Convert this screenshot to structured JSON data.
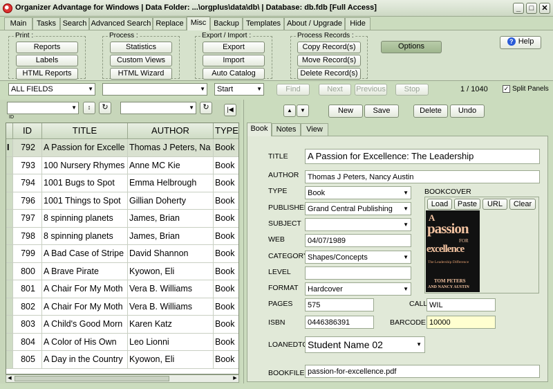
{
  "window": {
    "title": "Organizer Advantage for Windows | Data Folder: ...\\orgplus\\data\\db\\ | Database: db.fdb [Full Access]",
    "minimize": "_",
    "restore": "□",
    "close": "✕"
  },
  "tabs": [
    "Main",
    "Tasks",
    "Search",
    "Advanced Search",
    "Replace",
    "Misc",
    "Backup",
    "Templates",
    "About / Upgrade",
    "Hide"
  ],
  "ribbon": {
    "print": {
      "label": "Print :",
      "buttons": [
        "Reports",
        "Labels",
        "HTML Reports"
      ]
    },
    "process": {
      "label": "Process :",
      "buttons": [
        "Statistics",
        "Custom Views",
        "HTML Wizard"
      ]
    },
    "export_import": {
      "label": "Export / Import :",
      "buttons": [
        "Export",
        "Import",
        "Auto Catalog"
      ]
    },
    "process_records": {
      "label": "Process Records :",
      "buttons": [
        "Copy Record(s)",
        "Move Record(s)",
        "Delete Record(s)"
      ]
    },
    "options": "Options",
    "help": "Help"
  },
  "searchbar": {
    "field": "ALL FIELDS",
    "value": "",
    "mode": "Start",
    "find": "Find",
    "next": "Next",
    "previous": "Previous",
    "stop": "Stop",
    "record_counter": "1 / 1040",
    "split_panels": "Split Panels",
    "split_checked": true
  },
  "filter": {
    "sort_field": "",
    "sort_label": "ID",
    "filter2": ""
  },
  "grid": {
    "columns": [
      "ID",
      "TITLE",
      "AUTHOR",
      "TYPE"
    ],
    "rows": [
      {
        "marker": "I",
        "id": "792",
        "title": "A Passion for Excelle",
        "author": "Thomas J Peters, Na",
        "type": "Book",
        "selected": true
      },
      {
        "marker": "",
        "id": "793",
        "title": "100 Nursery Rhymes",
        "author": "Anne MC Kie",
        "type": "Book",
        "selected": false
      },
      {
        "marker": "",
        "id": "794",
        "title": "1001 Bugs to Spot",
        "author": "Emma Helbrough",
        "type": "Book",
        "selected": false
      },
      {
        "marker": "",
        "id": "796",
        "title": "1001 Things to Spot",
        "author": "Gillian Doherty",
        "type": "Book",
        "selected": false
      },
      {
        "marker": "",
        "id": "797",
        "title": "8 spinning planets",
        "author": "James, Brian",
        "type": "Book",
        "selected": false
      },
      {
        "marker": "",
        "id": "798",
        "title": "8 spinning planets",
        "author": "James, Brian",
        "type": "Book",
        "selected": false
      },
      {
        "marker": "",
        "id": "799",
        "title": "A Bad Case of Stripe",
        "author": "David Shannon",
        "type": "Book",
        "selected": false
      },
      {
        "marker": "",
        "id": "800",
        "title": "A Brave Pirate",
        "author": "Kyowon, Eli",
        "type": "Book",
        "selected": false
      },
      {
        "marker": "",
        "id": "801",
        "title": "A Chair For My Moth",
        "author": "Vera B. Williams",
        "type": "Book",
        "selected": false
      },
      {
        "marker": "",
        "id": "802",
        "title": "A Chair For My Moth",
        "author": "Vera B. Williams",
        "type": "Book",
        "selected": false
      },
      {
        "marker": "",
        "id": "803",
        "title": "A Child's Good Morn",
        "author": "Karen Katz",
        "type": "Book",
        "selected": false
      },
      {
        "marker": "",
        "id": "804",
        "title": "A Color of His Own",
        "author": "Leo Lionni",
        "type": "Book",
        "selected": false
      },
      {
        "marker": "",
        "id": "805",
        "title": "A Day in the Country",
        "author": "Kyowon, Eli",
        "type": "Book",
        "selected": false
      }
    ]
  },
  "record_toolbar": {
    "up": "▲",
    "down": "▼",
    "new": "New",
    "save": "Save",
    "delete": "Delete",
    "undo": "Undo"
  },
  "record_tabs": [
    "Book",
    "Notes",
    "View"
  ],
  "record": {
    "title_label": "TITLE",
    "title": "A Passion for Excellence: The Leadership",
    "author_label": "AUTHOR",
    "author": "Thomas J Peters, Nancy Austin",
    "type_label": "TYPE",
    "type": "Book",
    "published_label": "PUBLISHED",
    "published": "Grand Central Publishing",
    "subject_label": "SUBJECT",
    "subject": "",
    "web_label": "WEB",
    "web": "04/07/1989",
    "category_label": "CATEGORY",
    "category": "Shapes/Concepts",
    "level_label": "LEVEL",
    "level": "",
    "format_label": "FORMAT",
    "format": "Hardcover",
    "pages_label": "PAGES",
    "pages": "575",
    "call_label": "CALL",
    "call": "WIL",
    "isbn_label": "ISBN",
    "isbn": "0446386391",
    "barcode_label": "BARCODE",
    "barcode": "10000",
    "loanedto_label": "LOANEDTO",
    "loanedto": "Student Name 02",
    "bookfile_label": "BOOKFILE",
    "bookfile": "passion-for-excellence.pdf",
    "bookcover_label": "BOOKCOVER",
    "cover_buttons": [
      "Load",
      "Paste",
      "URL",
      "Clear"
    ],
    "cover_text": {
      "line1": "A",
      "line2": "passion",
      "line3": "FOR",
      "line4": "excellence",
      "line5": "The Leadership Difference",
      "line6": "TOM PETERS",
      "line7": "AND NANCY AUSTIN"
    }
  },
  "colors": {
    "background": "#cbdcbe",
    "barcode_bg": "#ffffd0",
    "cover_bg": "#111111",
    "cover_text": "#f2c2a0"
  }
}
